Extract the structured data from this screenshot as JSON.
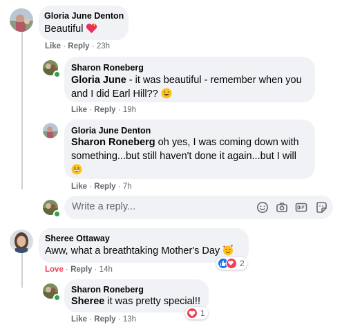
{
  "comments": [
    {
      "author": "Gloria June Denton",
      "text": "Beautiful",
      "like": "Like",
      "reply": "Reply",
      "time": "23h"
    },
    {
      "author": "Sharon Roneberg",
      "mention": "Gloria June",
      "text_line1": " - it was beautiful - remember when you",
      "text_line2": "and I did Earl Hill??",
      "like": "Like",
      "reply": "Reply",
      "time": "19h"
    },
    {
      "author": "Gloria June Denton",
      "mention": "Sharon Roneberg",
      "text_line1": " oh yes, I was coming down with",
      "text_line2": "something...but still haven't done it again...but I will",
      "like": "Like",
      "reply": "Reply",
      "time": "7h"
    },
    {
      "author": "Sheree Ottaway",
      "text": "Aww, what a breathtaking Mother's Day",
      "like": "Love",
      "reply": "Reply",
      "time": "14h",
      "reaction_count": "2"
    },
    {
      "author": "Sharon Roneberg",
      "mention": "Sheree",
      "text": " it was pretty special!!",
      "like": "Like",
      "reply": "Reply",
      "time": "13h",
      "reaction_count": "1"
    }
  ],
  "reply_box": {
    "placeholder": "Write a reply...",
    "icons": [
      "emoji-icon",
      "camera-icon",
      "gif-icon",
      "sticker-icon"
    ]
  },
  "separator": "·",
  "colors": {
    "bubble": "#f0f2f5",
    "meta": "#65676b",
    "love": "#f33e58",
    "online": "#31a24c",
    "like_blue": "#1877f2"
  }
}
